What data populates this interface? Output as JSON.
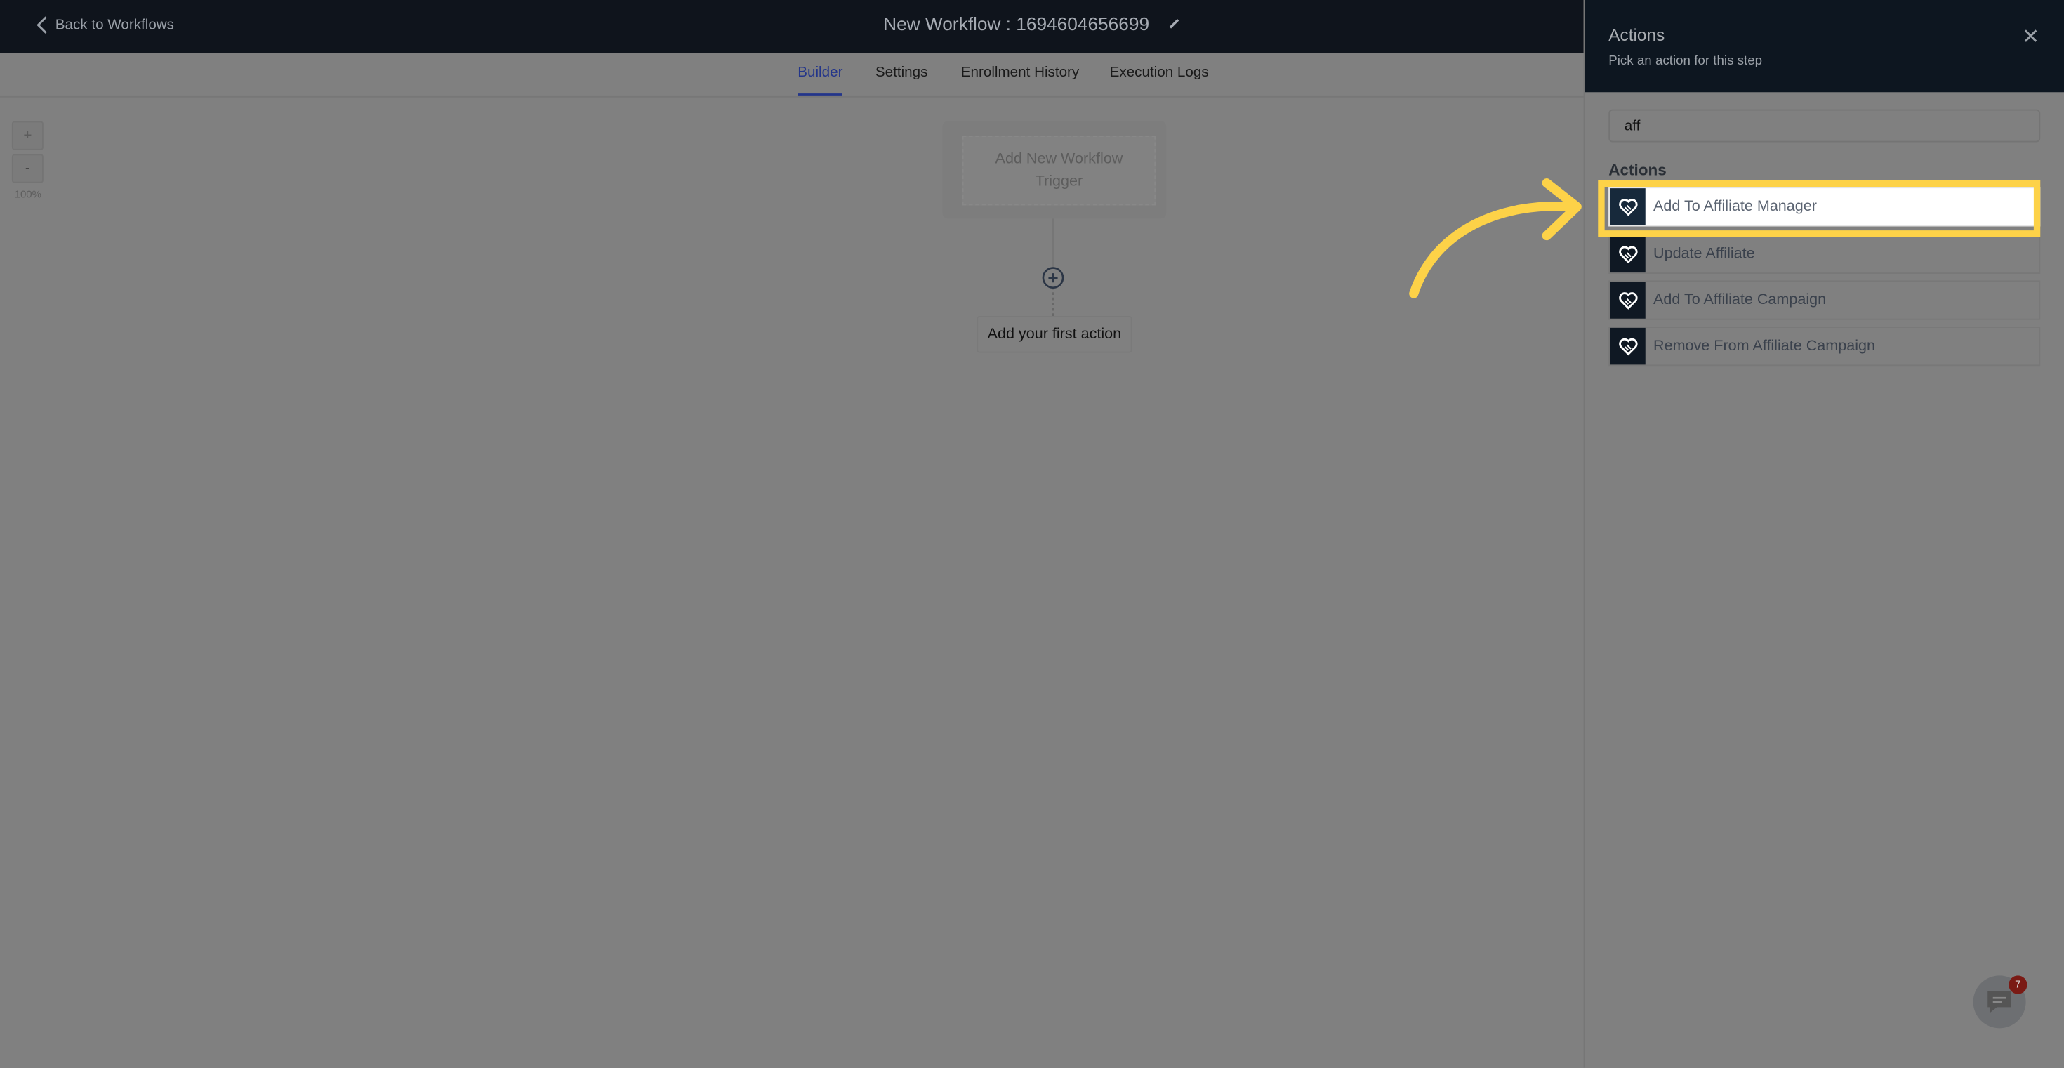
{
  "header": {
    "back_label": "Back to Workflows",
    "title": "New Workflow : 1694604656699"
  },
  "tabs": [
    {
      "label": "Builder",
      "active": true
    },
    {
      "label": "Settings"
    },
    {
      "label": "Enrollment History"
    },
    {
      "label": "Execution Logs"
    }
  ],
  "canvas": {
    "zoom_in": "+",
    "zoom_out": "-",
    "zoom_level": "100%",
    "trigger_label": "Add New Workflow Trigger",
    "first_action_label": "Add your first action"
  },
  "panel": {
    "title": "Actions",
    "subtitle": "Pick an action for this step",
    "search_value": "aff",
    "section_label": "Actions",
    "items": [
      {
        "label": "Add To Affiliate Manager",
        "icon": "handshake-heart-icon",
        "highlighted": true
      },
      {
        "label": "Update Affiliate",
        "icon": "handshake-heart-icon"
      },
      {
        "label": "Add To Affiliate Campaign",
        "icon": "handshake-heart-icon"
      },
      {
        "label": "Remove From Affiliate Campaign",
        "icon": "handshake-heart-icon"
      }
    ]
  },
  "chat": {
    "badge_count": "7"
  },
  "colors": {
    "highlight": "#fdd248",
    "accent": "#23358a",
    "header_bg": "#0f141c"
  }
}
